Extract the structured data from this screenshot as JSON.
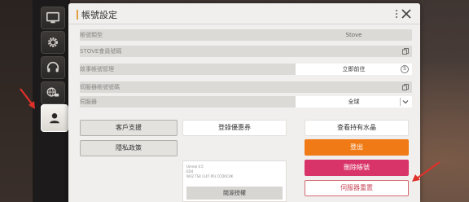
{
  "window": {
    "title": "帳號設定"
  },
  "colors": {
    "accent": "#e0a040",
    "orange": "#f07a16",
    "pink": "#d9346a",
    "arrow": "#e0302a"
  },
  "nav": {
    "items": [
      {
        "name": "display",
        "icon": "monitor-icon"
      },
      {
        "name": "settings",
        "icon": "gear-icon"
      },
      {
        "name": "audio",
        "icon": "headphones-icon"
      },
      {
        "name": "language",
        "icon": "globe-chat-icon"
      },
      {
        "name": "account",
        "icon": "user-icon",
        "active": true
      }
    ]
  },
  "rows": [
    {
      "label": "帳號類型",
      "value": "Stove"
    },
    {
      "label": "STOVE會員號碼",
      "value": ""
    },
    {
      "label": "故事帳號管理",
      "value": "立即前往"
    },
    {
      "label": "伺服器帳號號碼",
      "value": ""
    },
    {
      "label": "伺服器",
      "value": "全球"
    }
  ],
  "buttons": {
    "support": "客戶支援",
    "privacy": "隱私政策",
    "coupon": "登錄優惠券",
    "crystals": "查看持有水晶",
    "logout": "登出",
    "delete_account": "刪除帳號",
    "server_reset": "伺服器重置"
  },
  "info_box": {
    "lines": [
      "Unreal 4.5",
      "ED4",
      "W32 TS4 (147.95) CCDOC4K"
    ],
    "report_label": "閱源授權"
  }
}
